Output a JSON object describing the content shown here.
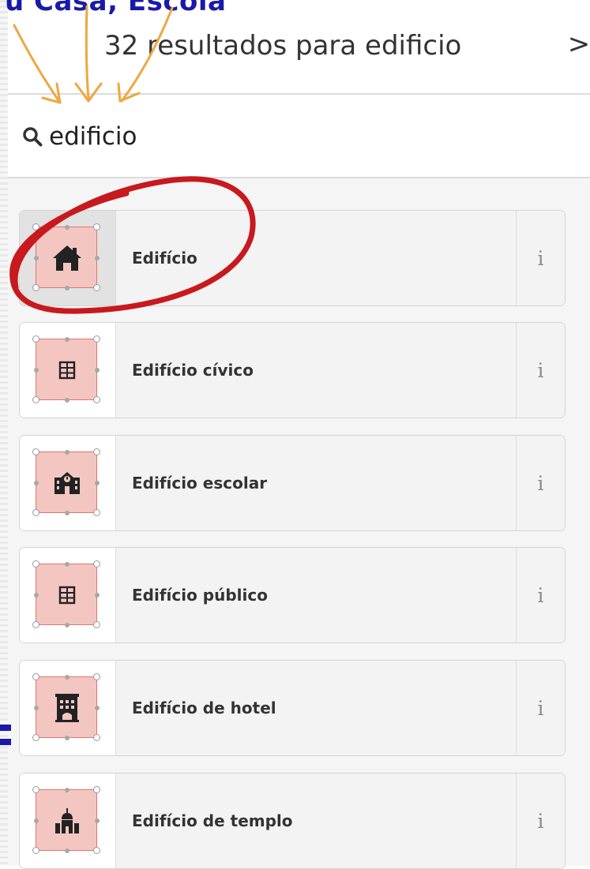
{
  "annotation": {
    "caption": "u Casa, Escola"
  },
  "header": {
    "results_text": "32 resultados para edificio",
    "next_label": ">"
  },
  "search": {
    "value": "edificio",
    "placeholder": ""
  },
  "presets": [
    {
      "label": "Edifício",
      "icon": "house-icon",
      "selected": true
    },
    {
      "label": "Edifício cívico",
      "icon": "building-grid-icon",
      "selected": false
    },
    {
      "label": "Edifício escolar",
      "icon": "school-icon",
      "selected": false
    },
    {
      "label": "Edifício público",
      "icon": "building-grid-icon",
      "selected": false
    },
    {
      "label": "Edifício de hotel",
      "icon": "hotel-icon",
      "selected": false
    },
    {
      "label": "Edifício de templo",
      "icon": "temple-icon",
      "selected": false
    }
  ],
  "info_label": "i",
  "colors": {
    "annotation_blue": "#1a1aa8",
    "arrow_orange": "#eea73e",
    "circle_red": "#c8191e",
    "preset_fill": "#f3c6c2",
    "preset_border": "#e0766b"
  }
}
